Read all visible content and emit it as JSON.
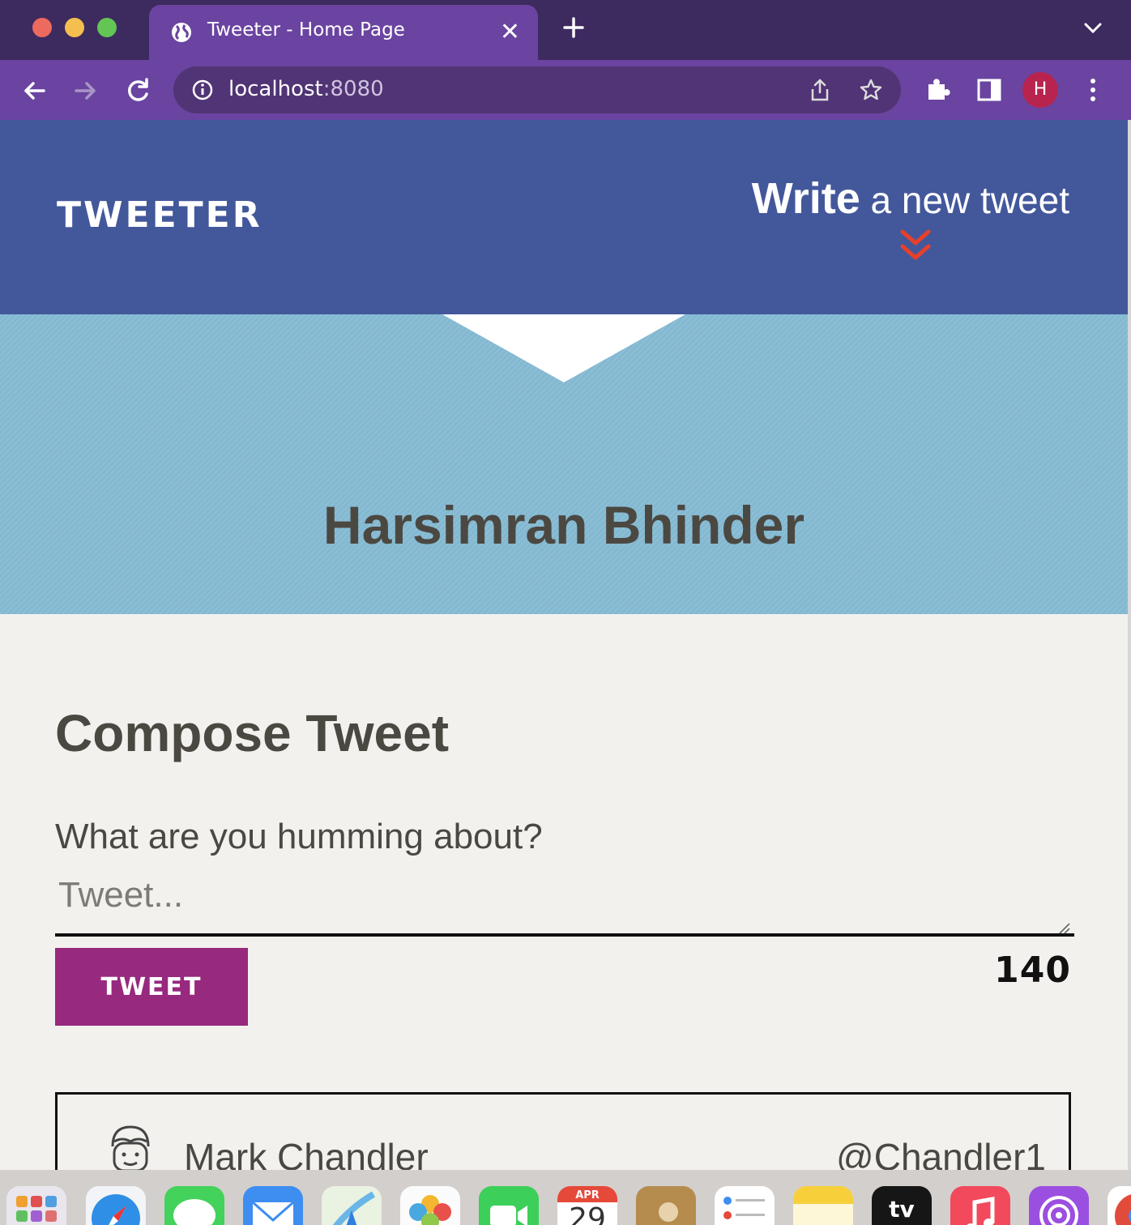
{
  "browser": {
    "tab_title": "Tweeter - Home Page",
    "url_host": "localhost",
    "url_port": ":8080",
    "profile_initial": "H"
  },
  "nav": {
    "logo": "TWEETER",
    "write_strong": "Write",
    "write_rest": " a new tweet",
    "accent_color": "#e8402a"
  },
  "profile_header": {
    "name": "Harsimran Bhinder"
  },
  "compose": {
    "title": "Compose Tweet",
    "label": "What are you humming about?",
    "placeholder": "Tweet...",
    "button_label": "TWEET",
    "counter": "140"
  },
  "tweets": [
    {
      "name": "Mark Chandler",
      "handle": "@Chandler1"
    }
  ],
  "dock": {
    "calendar_month": "APR",
    "calendar_day": "29",
    "tv_label": "tv"
  },
  "colors": {
    "nav_bg": "#43589b",
    "header_bg": "#86bcd4",
    "button_bg": "#97297e",
    "page_bg": "#f2f1ee"
  }
}
